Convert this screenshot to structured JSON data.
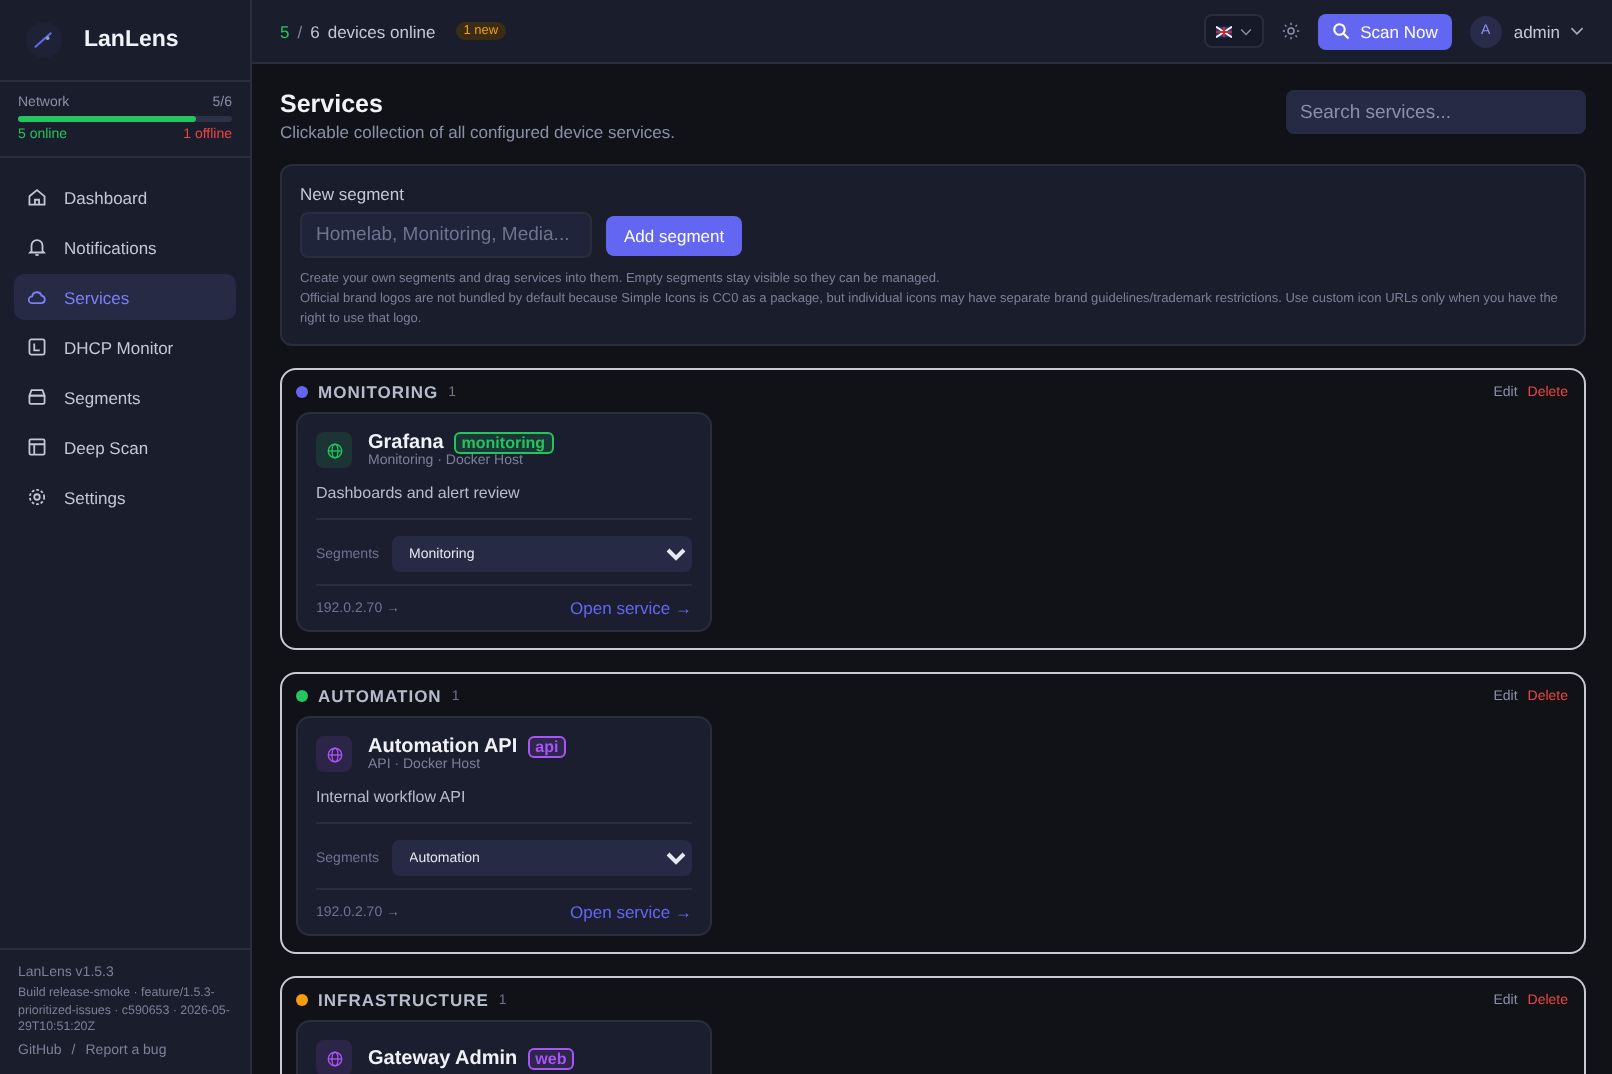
{
  "brand": {
    "name": "LanLens"
  },
  "network": {
    "label": "Network",
    "count": "5/6",
    "level": 0.83,
    "online": "5 online",
    "offline": "1 offline"
  },
  "nav": [
    {
      "label": "Dashboard",
      "selected": false
    },
    {
      "label": "Notifications",
      "selected": false
    },
    {
      "label": "Services",
      "selected": true
    },
    {
      "label": "DHCP Monitor",
      "selected": false
    },
    {
      "label": "Segments",
      "selected": false
    },
    {
      "label": "Deep Scan",
      "selected": false
    },
    {
      "label": "Settings",
      "selected": false
    }
  ],
  "footer": {
    "version": "LanLens v1.5.3",
    "build": "Build release-smoke · feature/1.5.3-prioritized-issues · c590653 · 2026-05-29T10:51:20Z",
    "links": [
      "GitHub",
      "Report a bug"
    ],
    "separator": "/"
  },
  "topbar": {
    "online": "5",
    "sep": "/",
    "total": "6",
    "label": "devices online",
    "badge": "1 new",
    "scan": "Scan Now",
    "avatar": "A",
    "user": "admin"
  },
  "page": {
    "title": "Services",
    "subtitle": "Clickable collection of all configured device services.",
    "search_placeholder": "Search services..."
  },
  "new_segment": {
    "label": "New segment",
    "placeholder": "Homelab, Monitoring, Media...",
    "button": "Add segment",
    "hint": "Create your own segments and drag services into them. Empty segments stay visible so they can be managed.",
    "note": "Official brand logos are not bundled by default because Simple Icons is CC0 as a package, but individual icons may have separate brand guidelines/trademark restrictions. Use custom icon URLs only when you have the right to use that logo."
  },
  "segments": [
    {
      "name": "MONITORING",
      "count": "1",
      "color": "#6366f1",
      "edit": "Edit",
      "delete": "Delete",
      "services": [
        {
          "name": "Grafana",
          "tag": "monitoring",
          "color": "#22c55e",
          "meta": "Monitoring · Docker Host",
          "description": "Dashboards and alert review",
          "segments_label": "Segments",
          "segment": "Monitoring",
          "address": "192.0.2.70 →",
          "open": "Open service →"
        }
      ]
    },
    {
      "name": "AUTOMATION",
      "count": "1",
      "color": "#22c55e",
      "edit": "Edit",
      "delete": "Delete",
      "services": [
        {
          "name": "Automation API",
          "tag": "api",
          "color": "#a855f7",
          "meta": "API · Docker Host",
          "description": "Internal workflow API",
          "segments_label": "Segments",
          "segment": "Automation",
          "address": "192.0.2.70 →",
          "open": "Open service →"
        }
      ]
    },
    {
      "name": "INFRASTRUCTURE",
      "count": "1",
      "color": "#f59e0b",
      "edit": "Edit",
      "delete": "Delete",
      "services": [
        {
          "name": "Gateway Admin",
          "tag": "web",
          "color": "#a855f7"
        }
      ]
    }
  ]
}
